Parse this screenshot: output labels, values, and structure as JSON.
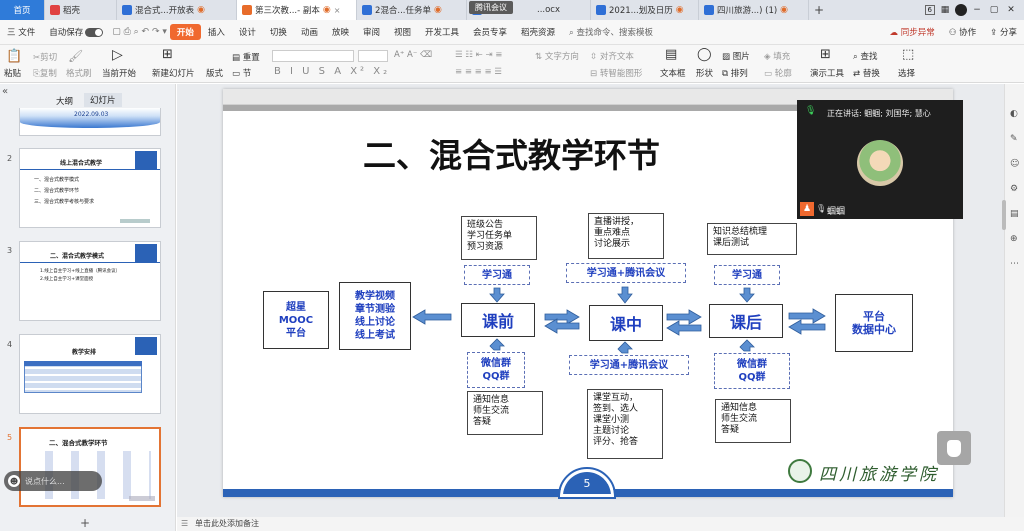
{
  "tabs": [
    {
      "label": "首页"
    },
    {
      "label": "稻壳",
      "badge": "#e04141"
    },
    {
      "label": "混合式...开放表",
      "badge": "#2f6fd6"
    },
    {
      "label": "第三次教...- 副本",
      "badge": "#e86c2a"
    },
    {
      "label": "2混合...任务单",
      "badge": "#2f6fd6"
    },
    {
      "label": "...ocx",
      "badge": "#2f6fd6"
    },
    {
      "label": "2021...划及日历",
      "badge": "#2f6fd6"
    },
    {
      "label": "四川旅游...) (1)",
      "badge": "#2f6fd6"
    }
  ],
  "tab_overlay": "腾讯会议",
  "tabbar_right": {
    "page_count": "6",
    "new_tab": "+"
  },
  "menu": {
    "file": "三 文件",
    "autosave": "自动保存",
    "start": "开始",
    "items": [
      "插入",
      "设计",
      "切换",
      "动画",
      "放映",
      "审阅",
      "视图",
      "开发工具",
      "会员专享",
      "稻壳资源"
    ],
    "search": "查找命令、搜索模板",
    "sync": "同步异常",
    "collab": "协作",
    "share": "分享"
  },
  "ribbon": {
    "paste": "粘贴",
    "cut": "剪切",
    "copy": "复制",
    "format_painter": "格式刷",
    "from_current": "当前开始",
    "new_slide": "新建幻灯片",
    "layout": "版式",
    "reset": "重置",
    "section": "节",
    "text_box": "文本框",
    "shape": "形状",
    "picture": "图片",
    "fill": "填充",
    "arrange": "排列",
    "outline": "轮廓",
    "presentation_tool": "演示工具",
    "find": "查找",
    "replace": "替换",
    "select": "选择",
    "text_dir": "文字方向",
    "align_text": "对齐文本",
    "smartart": "转智能图形"
  },
  "panel": {
    "tab_outline": "大纲",
    "tab_slides": "幻灯片",
    "slides": [
      {
        "num": "",
        "date": "2022.09.03"
      },
      {
        "num": "2",
        "title": "线上混合式教学",
        "lines": [
          "一、混合式教学模式",
          "二、混合式教学环节",
          "三、混合式教学考核与要求"
        ]
      },
      {
        "num": "3",
        "title": "二、混合式教学模式",
        "lines": [
          "1.线上自主学习+线上直播（腾讯会议）",
          "2.线上自主学习+课堂面授"
        ]
      },
      {
        "num": "4",
        "title": "教学安排",
        "lines": []
      },
      {
        "num": "5",
        "title": "二、混合式教学环节",
        "lines": []
      }
    ],
    "chat_hint": "说点什么...",
    "add": "+"
  },
  "slide": {
    "title": "二、混合式教学环节",
    "page_number": "5",
    "school": "四川旅游学院",
    "platform_left": "超星\nMOOC\n平台",
    "resources": "教学视频\n章节测验\n线上讨论\n线上考试",
    "before": "课前",
    "during": "课中",
    "after": "课后",
    "data_center": "平台\n数据中心",
    "before_top": "班级公告\n学习任务单\n预习资源",
    "during_top": "直播讲授，\n重点难点\n讨论展示",
    "after_top": "知识总结梳理\n课后测试",
    "before_tool_top": "学习通",
    "during_tool_top": "学习通+腾讯会议",
    "after_tool_top": "学习通",
    "before_tool_bottom": "微信群\nQQ群",
    "during_tool_bottom": "学习通+腾讯会议",
    "after_tool_bottom": "微信群\nQQ群",
    "before_bottom": "通知信息\n师生交流\n答疑",
    "during_bottom": "课堂互动，\n签到、选人\n课堂小测\n主题讨论\n评分、抢答",
    "after_bottom": "通知信息\n师生交流\n答疑"
  },
  "video": {
    "speaking": "正在讲话: 蝈蝈; 刘国华; 慧心",
    "name": "蝈蝈"
  },
  "status": {
    "notes": "单击此处添加备注"
  }
}
